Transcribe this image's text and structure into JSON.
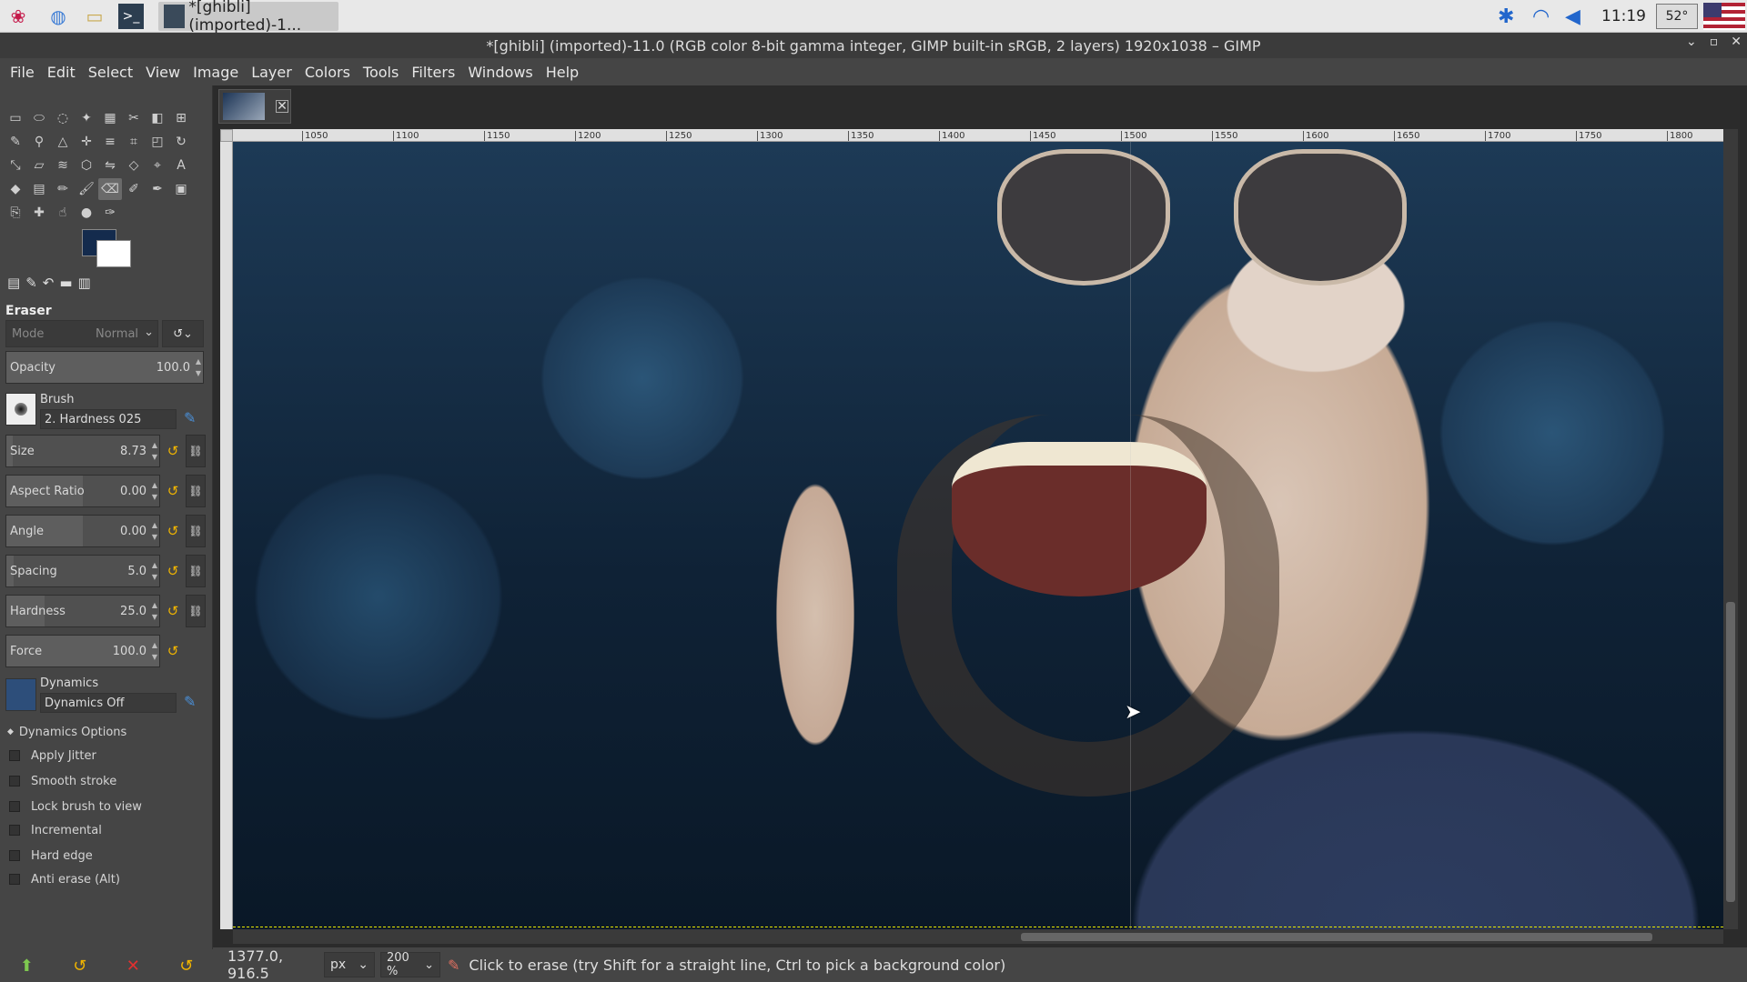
{
  "taskbar": {
    "task_title": "*[ghibli] (imported)-1...",
    "clock": "11:19",
    "temperature": "52°",
    "icons": [
      "raspberry-icon",
      "browser-icon",
      "folder-icon",
      "terminal-icon",
      "bluetooth-icon",
      "wifi-icon",
      "volume-icon"
    ]
  },
  "window": {
    "title": "*[ghibli] (imported)-11.0 (RGB color 8-bit gamma integer, GIMP built-in sRGB, 2 layers) 1920x1038 – GIMP"
  },
  "menu": [
    "File",
    "Edit",
    "Select",
    "View",
    "Image",
    "Layer",
    "Colors",
    "Tools",
    "Filters",
    "Windows",
    "Help"
  ],
  "colors": {
    "foreground": "#142b4d",
    "background": "#ffffff"
  },
  "tool_options": {
    "title": "Eraser",
    "mode_label": "Mode",
    "mode_value": "Normal",
    "opacity": {
      "label": "Opacity",
      "value": "100.0"
    },
    "brush": {
      "label": "Brush",
      "value": "2. Hardness 025"
    },
    "size": {
      "label": "Size",
      "value": "8.73"
    },
    "aspect_ratio": {
      "label": "Aspect Ratio",
      "value": "0.00"
    },
    "angle": {
      "label": "Angle",
      "value": "0.00"
    },
    "spacing": {
      "label": "Spacing",
      "value": "5.0"
    },
    "hardness": {
      "label": "Hardness",
      "value": "25.0"
    },
    "force": {
      "label": "Force",
      "value": "100.0"
    },
    "dynamics": {
      "label": "Dynamics",
      "value": "Dynamics Off"
    },
    "dynamics_options": "Dynamics Options",
    "checkboxes": [
      "Apply Jitter",
      "Smooth stroke",
      "Lock brush to view",
      "Incremental",
      "Hard edge",
      "Anti erase  (Alt)"
    ]
  },
  "ruler": {
    "ticks": [
      "1050",
      "1100",
      "1150",
      "1200",
      "1250",
      "1300",
      "1350",
      "1400",
      "1450",
      "1500",
      "1550",
      "1600",
      "1650",
      "1700",
      "1750",
      "1800"
    ]
  },
  "status": {
    "coords": "1377.0, 916.5",
    "unit": "px",
    "zoom": "200 %",
    "message": "Click to erase (try Shift for a straight line, Ctrl to pick a background color)"
  }
}
